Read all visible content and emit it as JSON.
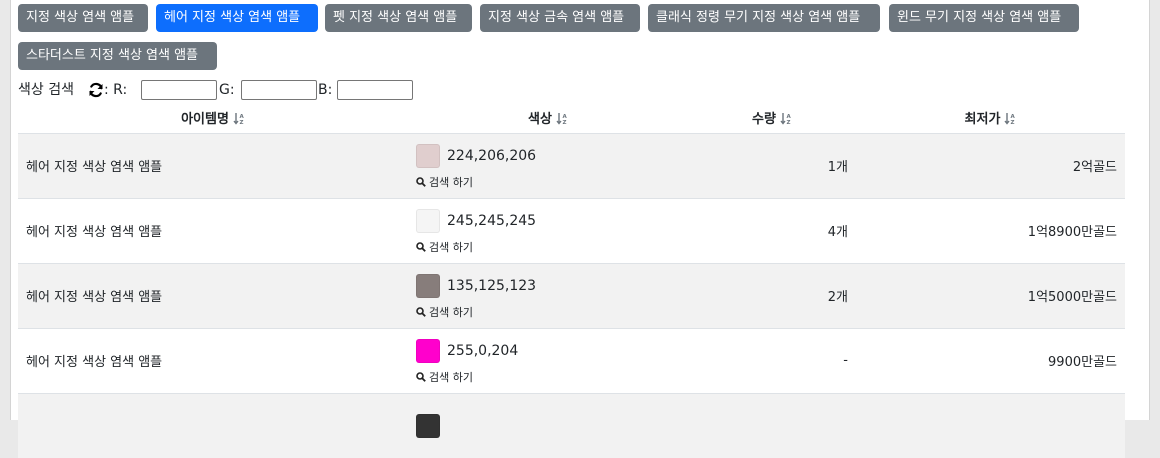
{
  "tabs": [
    {
      "label": "지정 색상 염색 앰플",
      "active": false
    },
    {
      "label": "헤어 지정 색상 염색 앰플",
      "active": true
    },
    {
      "label": "펫 지정 색상 염색 앰플",
      "active": false
    },
    {
      "label": "지정 색상 금속 염색 앰플",
      "active": false
    },
    {
      "label": "클래식 정령 무기 지정 색상 염색 앰플",
      "active": false
    },
    {
      "label": "윈드 무기 지정 색상 염색 앰플",
      "active": false
    },
    {
      "label": "스타더스트 지정 색상 염색 앰플",
      "active": false
    }
  ],
  "search": {
    "label": "색상 검색",
    "refresh_icon": "refresh-icon",
    "r_label": ": R:",
    "g_label": "G:",
    "b_label": "B:",
    "r_value": "",
    "g_value": "",
    "b_value": ""
  },
  "table": {
    "headers": {
      "name": "아이템명",
      "color": "색상",
      "qty": "수량",
      "price": "최저가"
    },
    "sort_icon": "sort-icon",
    "search_link": "검색 하기",
    "rows": [
      {
        "name": "헤어 지정 색상 염색 앰플",
        "swatch": "#e0cece",
        "rgb": "224,206,206",
        "qty": "1개",
        "price": "2억골드"
      },
      {
        "name": "헤어 지정 색상 염색 앰플",
        "swatch": "#f5f5f5",
        "rgb": "245,245,245",
        "qty": "4개",
        "price": "1억8900만골드"
      },
      {
        "name": "헤어 지정 색상 염색 앰플",
        "swatch": "#877d7b",
        "rgb": "135,125,123",
        "qty": "2개",
        "price": "1억5000만골드"
      },
      {
        "name": "헤어 지정 색상 염색 앰플",
        "swatch": "#ff00cc",
        "rgb": "255,0,204",
        "qty": "-",
        "price": "9900만골드"
      }
    ]
  },
  "colors": {
    "active_tab": "#0d6efd",
    "inactive_tab": "#6c757d",
    "stripe": "#f2f2f2"
  }
}
